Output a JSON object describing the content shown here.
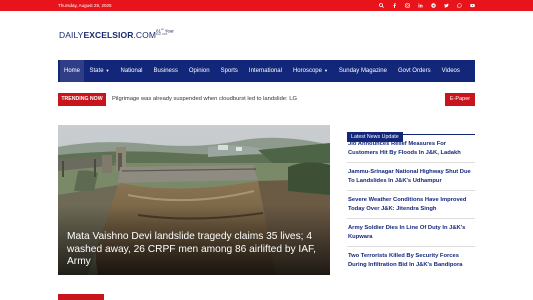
{
  "topbar": {
    "date": "Thursday, August 28, 2025",
    "icons": [
      "search-icon",
      "facebook-icon",
      "instagram-icon",
      "linkedin-icon",
      "telegram-icon",
      "twitter-icon",
      "whatsapp-icon",
      "youtube-icon"
    ],
    "color": "#e8141b"
  },
  "logo": {
    "daily": "DAILY",
    "excelsior": "EXCELSIOR",
    "com": ".COM",
    "year": "61",
    "year_suffix": "st",
    "year_word": "Year",
    "estd": "Estd 1965"
  },
  "nav": {
    "items": [
      {
        "label": "Home"
      },
      {
        "label": "State",
        "dropdown": true
      },
      {
        "label": "National"
      },
      {
        "label": "Business"
      },
      {
        "label": "Opinion"
      },
      {
        "label": "Sports"
      },
      {
        "label": "International"
      },
      {
        "label": "Horoscope",
        "dropdown": true
      },
      {
        "label": "Sunday Magazine"
      },
      {
        "label": "Govt Orders"
      },
      {
        "label": "Videos"
      }
    ],
    "caret": "▼",
    "color": "#13277a"
  },
  "ticker": {
    "label": "TRENDING NOW",
    "text": "Pilgrimage was already suspended when cloudburst led to landslide: LG",
    "epaper": "E-Paper"
  },
  "hero": {
    "headline": "Mata Vaishno Devi landslide tragedy claims 35 lives; 4 washed away, 26 CRPF men among 86 airlifted by IAF, Army"
  },
  "sidebar": {
    "title": "Latest News Update",
    "items": [
      "Jio Announces Relief Measures For Customers Hit By Floods In J&K, Ladakh",
      "Jammu-Srinagar National Highway Shut Due To Landslides In J&K's Udhampur",
      "Severe Weather Conditions Have Improved Today Over J&K: Jitendra Singh",
      "Army Soldier Dies In Line Of Duty In J&K's Kupwara",
      "Two Terrorists Killed By Security Forces During Infiltration Bid In J&K's Bandipora"
    ]
  }
}
